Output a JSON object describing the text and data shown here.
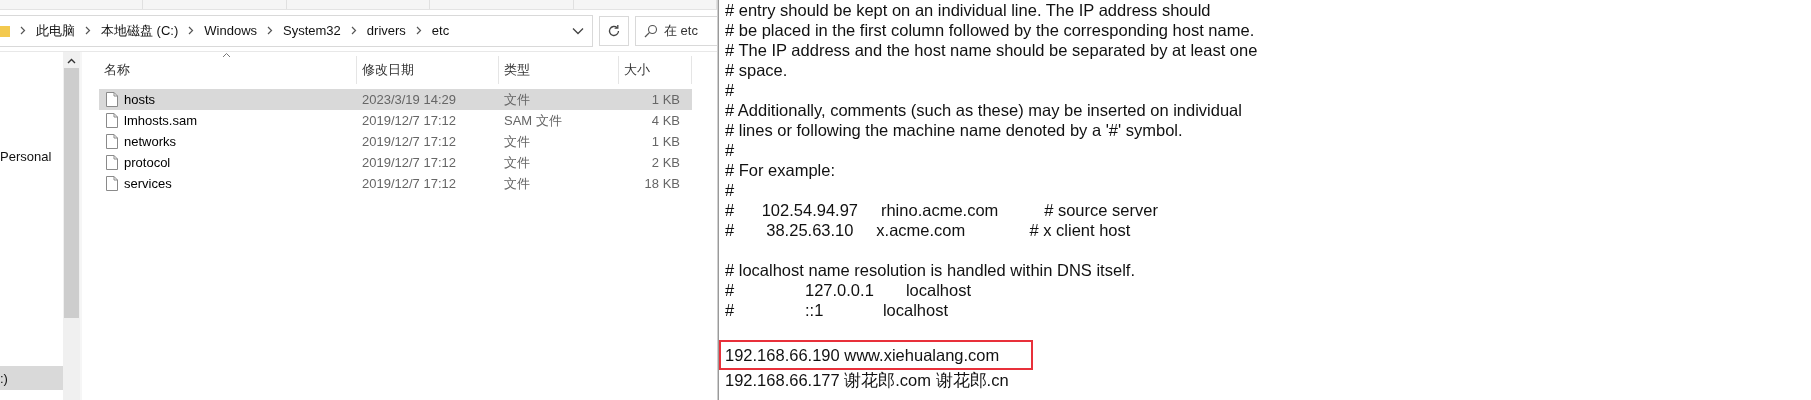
{
  "explorer": {
    "breadcrumb": [
      "此电脑",
      "本地磁盘 (C:)",
      "Windows",
      "System32",
      "drivers",
      "etc"
    ],
    "search": {
      "placeholder": "在 etc"
    },
    "nav": [
      {
        "label": "Personal",
        "selected": false
      },
      {
        "label": ":)",
        "selected": true
      }
    ],
    "columns": [
      "名称",
      "修改日期",
      "类型",
      "大小"
    ],
    "files": [
      {
        "name": "hosts",
        "modified": "2023/3/19 14:29",
        "type": "文件",
        "size": "1 KB",
        "selected": true
      },
      {
        "name": "lmhosts.sam",
        "modified": "2019/12/7 17:12",
        "type": "SAM 文件",
        "size": "4 KB",
        "selected": false
      },
      {
        "name": "networks",
        "modified": "2019/12/7 17:12",
        "type": "文件",
        "size": "1 KB",
        "selected": false
      },
      {
        "name": "protocol",
        "modified": "2019/12/7 17:12",
        "type": "文件",
        "size": "2 KB",
        "selected": false
      },
      {
        "name": "services",
        "modified": "2019/12/7 17:12",
        "type": "文件",
        "size": "18 KB",
        "selected": false
      }
    ]
  },
  "editor": {
    "lines": [
      {
        "kind": "text",
        "text": "# entry should be kept on an individual line. The IP address should",
        "highlighted": false
      },
      {
        "kind": "text",
        "text": "# be placed in the first column followed by the corresponding host name.",
        "highlighted": false
      },
      {
        "kind": "text",
        "text": "# The IP address and the host name should be separated by at least one",
        "highlighted": false
      },
      {
        "kind": "text",
        "text": "# space.",
        "highlighted": false
      },
      {
        "kind": "text",
        "text": "#",
        "highlighted": false
      },
      {
        "kind": "text",
        "text": "# Additionally, comments (such as these) may be inserted on individual",
        "highlighted": false
      },
      {
        "kind": "text",
        "text": "# lines or following the machine name denoted by a '#' symbol.",
        "highlighted": false
      },
      {
        "kind": "text",
        "text": "#",
        "highlighted": false
      },
      {
        "kind": "text",
        "text": "# For example:",
        "highlighted": false
      },
      {
        "kind": "text",
        "text": "#",
        "highlighted": false
      },
      {
        "kind": "text",
        "text": "#      102.54.94.97     rhino.acme.com          # source server",
        "highlighted": false
      },
      {
        "kind": "text",
        "text": "#       38.25.63.10     x.acme.com              # x client host",
        "highlighted": false
      },
      {
        "kind": "blank"
      },
      {
        "kind": "text",
        "text": "# localhost name resolution is handled within DNS itself.",
        "highlighted": false
      },
      {
        "kind": "text",
        "text": "#\t127.0.0.1       localhost",
        "highlighted": false
      },
      {
        "kind": "text",
        "text": "#\t::1             localhost",
        "highlighted": false
      },
      {
        "kind": "blank"
      },
      {
        "kind": "text",
        "text": "192.168.66.190 www.xiehualang.com",
        "highlighted": true
      },
      {
        "kind": "text",
        "text": "192.168.66.177 谢花郎.com 谢花郎.cn",
        "highlighted": false
      }
    ]
  }
}
